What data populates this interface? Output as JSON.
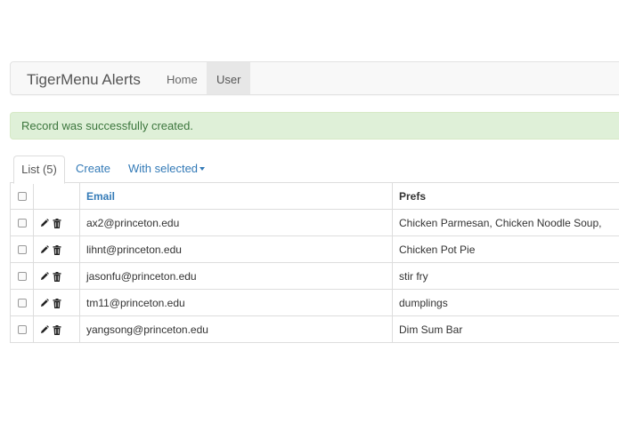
{
  "navbar": {
    "brand": "TigerMenu Alerts",
    "links": [
      {
        "label": "Home",
        "active": false
      },
      {
        "label": "User",
        "active": true
      }
    ]
  },
  "alert": {
    "message": "Record was successfully created.",
    "color": "#dff0d8"
  },
  "tabs": {
    "list": "List (5)",
    "create": "Create",
    "with_selected": "With selected"
  },
  "table": {
    "headers": {
      "email": "Email",
      "prefs": "Prefs"
    },
    "rows": [
      {
        "email": "ax2@princeton.edu",
        "prefs": "Chicken Parmesan, Chicken Noodle Soup,"
      },
      {
        "email": "lihnt@princeton.edu",
        "prefs": "Chicken Pot Pie"
      },
      {
        "email": "jasonfu@princeton.edu",
        "prefs": "stir fry"
      },
      {
        "email": "tm11@princeton.edu",
        "prefs": "dumplings"
      },
      {
        "email": "yangsong@princeton.edu",
        "prefs": "Dim Sum Bar"
      }
    ],
    "row_icons": [
      "pencil-icon",
      "trash-icon"
    ]
  },
  "colors": {
    "link": "#337ab7",
    "alert_text": "#3c763d"
  }
}
